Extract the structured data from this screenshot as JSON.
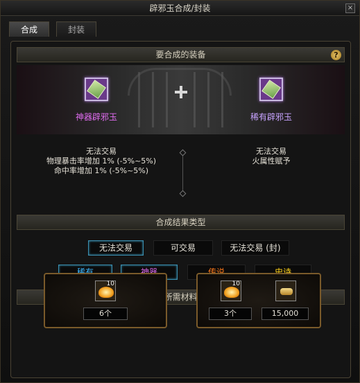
{
  "window": {
    "title": "辟邪玉合成/封装"
  },
  "tabs": [
    {
      "label": "合成"
    },
    {
      "label": "封装"
    }
  ],
  "equip_section": {
    "header": "要合成的装备",
    "help": "?",
    "left_item": {
      "name": "神器辟邪玉",
      "tradeable": "无法交易",
      "stats": [
        "物理暴击率增加 1% (-5%~5%)",
        "命中率增加 1% (-5%~5%)"
      ]
    },
    "right_item": {
      "name": "稀有辟邪玉",
      "tradeable": "无法交易",
      "stats": [
        "火属性赋予"
      ]
    }
  },
  "result_section": {
    "header": "合成结果类型",
    "trade_options": [
      "无法交易",
      "可交易",
      "无法交易 (封)"
    ],
    "rarity_options": [
      "稀有",
      "神器",
      "传说",
      "史诗"
    ]
  },
  "materials_section": {
    "header": "所需材料",
    "left": {
      "icon_count": "10",
      "qty": "6个"
    },
    "right": {
      "icon_count": "10",
      "qty": "3个",
      "gold": "15,000"
    }
  },
  "colors": {
    "rare": "#3db8ff",
    "epic_artifact": "#e06cf0",
    "legendary": "#ff7a1a",
    "epic": "#ffd21a"
  }
}
